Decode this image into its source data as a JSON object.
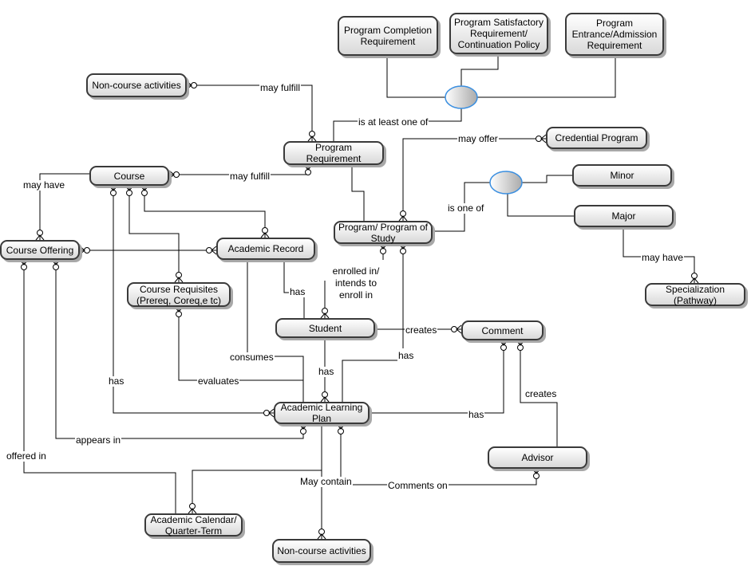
{
  "entities": {
    "program_completion": "Program Completion Requirement",
    "program_satisfactory": "Program Satisfactory Requirement/ Continuation Policy",
    "program_entrance": "Program Entrance/Admission Requirement",
    "noncourse_top": "Non-course activities",
    "program_requirement": "Program Requirement",
    "credential_program": "Credential Program",
    "course": "Course",
    "minor": "Minor",
    "major": "Major",
    "program_of_study": "Program/ Program of Study",
    "course_offering": "Course Offering",
    "academic_record": "Academic Record",
    "course_requisites": "Course Requisites (Prereq, Coreq,e tc)",
    "specialization": "Specialization (Pathway)",
    "student": "Student",
    "comment": "Comment",
    "academic_learning_plan": "Academic Learning Plan",
    "advisor": "Advisor",
    "academic_calendar": "Academic Calendar/ Quarter-Term",
    "noncourse_bottom": "Non-course activities"
  },
  "relationships": {
    "is_at_least_one_of": "is at least one of",
    "may_fulfill_1": "may fulfill",
    "may_fulfill_2": "may fulfill",
    "may_offer": "may offer",
    "is_one_of": "is one of",
    "may_have_major": "may have",
    "may_have_course": "may have",
    "has_course_alp": "has",
    "evaluates": "evaluates",
    "consumes": "consumes",
    "has_record_student": "has",
    "enrolled_in": "enrolled in/ intends to enroll in",
    "creates_student": "creates",
    "has_student_alp": "has",
    "has_program_alp": "has",
    "has_comment_alp": "has",
    "creates_advisor": "creates",
    "offered_in": "offered in",
    "appears_in": "appears in",
    "may_contain": "May contain",
    "comments_on": "Comments on"
  },
  "colors": {
    "line": "#000000",
    "entity_border": "#3a3a3a",
    "ellipse_border": "#3b8fe0"
  }
}
